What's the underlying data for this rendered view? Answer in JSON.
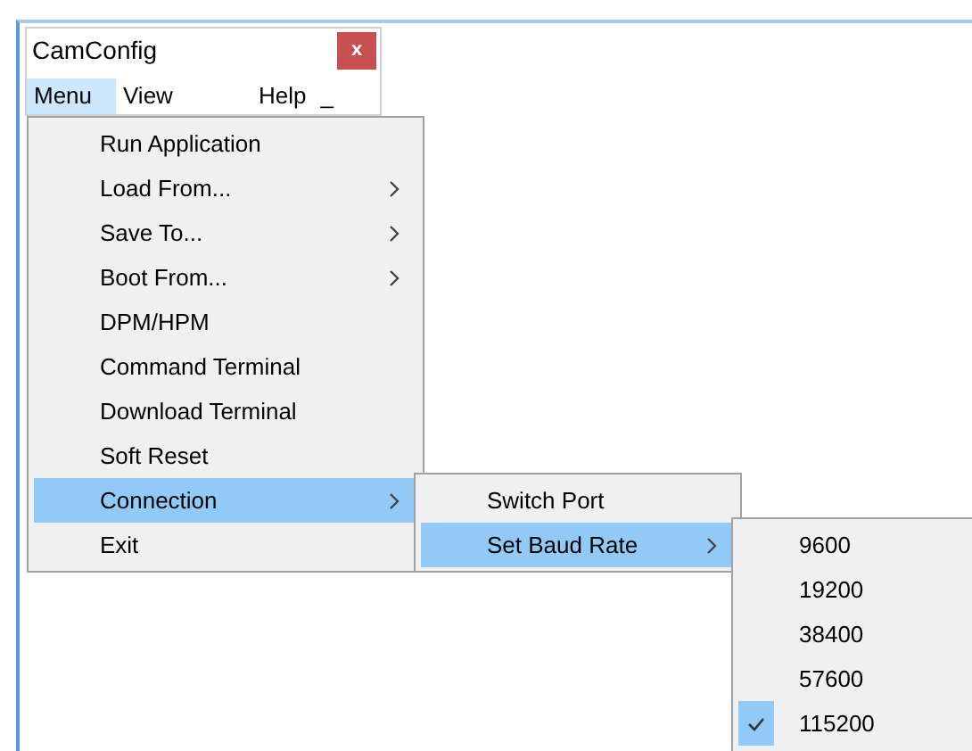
{
  "window": {
    "title": "CamConfig",
    "close": "x"
  },
  "menubar": [
    {
      "label": "Menu",
      "selected": true
    },
    {
      "label": "View",
      "selected": false
    },
    {
      "label": "Help",
      "selected": false
    },
    {
      "label": "_",
      "selected": false
    }
  ],
  "menu": [
    {
      "label": "Run Application",
      "submenu": false,
      "selected": false
    },
    {
      "label": "Load From...",
      "submenu": true,
      "selected": false
    },
    {
      "label": "Save To...",
      "submenu": true,
      "selected": false
    },
    {
      "label": "Boot From...",
      "submenu": true,
      "selected": false
    },
    {
      "label": "DPM/HPM",
      "submenu": false,
      "selected": false
    },
    {
      "label": "Command Terminal",
      "submenu": false,
      "selected": false
    },
    {
      "label": "Download Terminal",
      "submenu": false,
      "selected": false
    },
    {
      "label": "Soft Reset",
      "submenu": false,
      "selected": false
    },
    {
      "label": "Connection",
      "submenu": true,
      "selected": true
    },
    {
      "label": "Exit",
      "submenu": false,
      "selected": false
    }
  ],
  "connection_menu": [
    {
      "label": "Switch Port",
      "submenu": false,
      "selected": false
    },
    {
      "label": "Set Baud Rate",
      "submenu": true,
      "selected": true
    }
  ],
  "baud_rate_menu": [
    {
      "label": "9600",
      "checked": false
    },
    {
      "label": "19200",
      "checked": false
    },
    {
      "label": "38400",
      "checked": false
    },
    {
      "label": "57600",
      "checked": false
    },
    {
      "label": "115200",
      "checked": true
    }
  ]
}
